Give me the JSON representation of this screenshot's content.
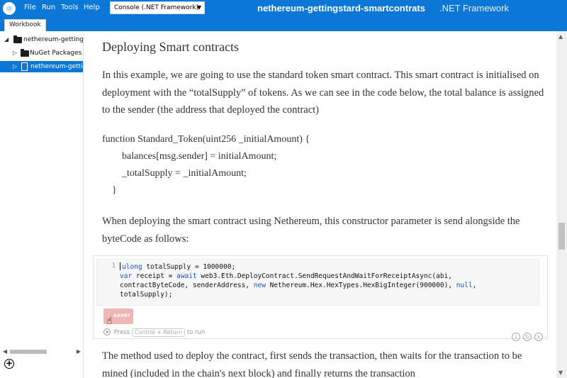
{
  "menubar": {
    "items": [
      "File",
      "Run",
      "Tools",
      "Help"
    ],
    "target_select": "Console (.NET Framework)",
    "window_title": "nethereum-gettingstard-smartcontrats",
    "window_subtitle": ".NET Framework"
  },
  "tabs": {
    "workbook": "Workbook"
  },
  "sidebar": {
    "items": [
      {
        "label": "nethereum-gettings"
      },
      {
        "label": "NuGet Packages"
      },
      {
        "label": "nethereum-gettin"
      }
    ]
  },
  "document": {
    "heading": "Deploying Smart contracts",
    "para1": "In this example, we are going to use the standard token smart contract. This smart contract is initialised on deployment with the “totalSupply” of tokens. As we can see in the code below, the total balance is assigned to the sender (the address that deployed the contract)",
    "solidity": [
      "function Standard_Token(uint256 _initialAmount) {",
      "balances[msg.sender] =   initialAmount;",
      "_totalSupply = _initialAmount;",
      "}"
    ],
    "para2": "When deploying the smart contract using Nethereum, this constructor parameter is send alongside the byteCode as follows:",
    "para3": "The method used to deploy the contract, first sends the transaction, then waits for the transaction to be mined (included in the chain's next block) and finally returns the transaction"
  },
  "cell": {
    "line_number": "1",
    "code": {
      "l1_kw": "ulong",
      "l1_rest": " totalSupply = 1000000;",
      "l2_kw1": "var",
      "l2_mid": " receipt = ",
      "l2_kw2": "await",
      "l2_rest": " web3.Eth.DeployContract.SendRequestAndWaitForReceiptAsync(abi,",
      "l3_a": "contractByteCode, senderAddress,  ",
      "l3_kw": "new",
      "l3_b": " Nethereum.Hex.HexTypes.HexBigInteger(900000), ",
      "l3_kw2": "null",
      "l3_c": ",",
      "l4": "totalSupply);"
    },
    "abort_label": "ABORT",
    "hint_prefix": "Press",
    "hint_key": "Control + Return",
    "hint_suffix": "to run"
  }
}
